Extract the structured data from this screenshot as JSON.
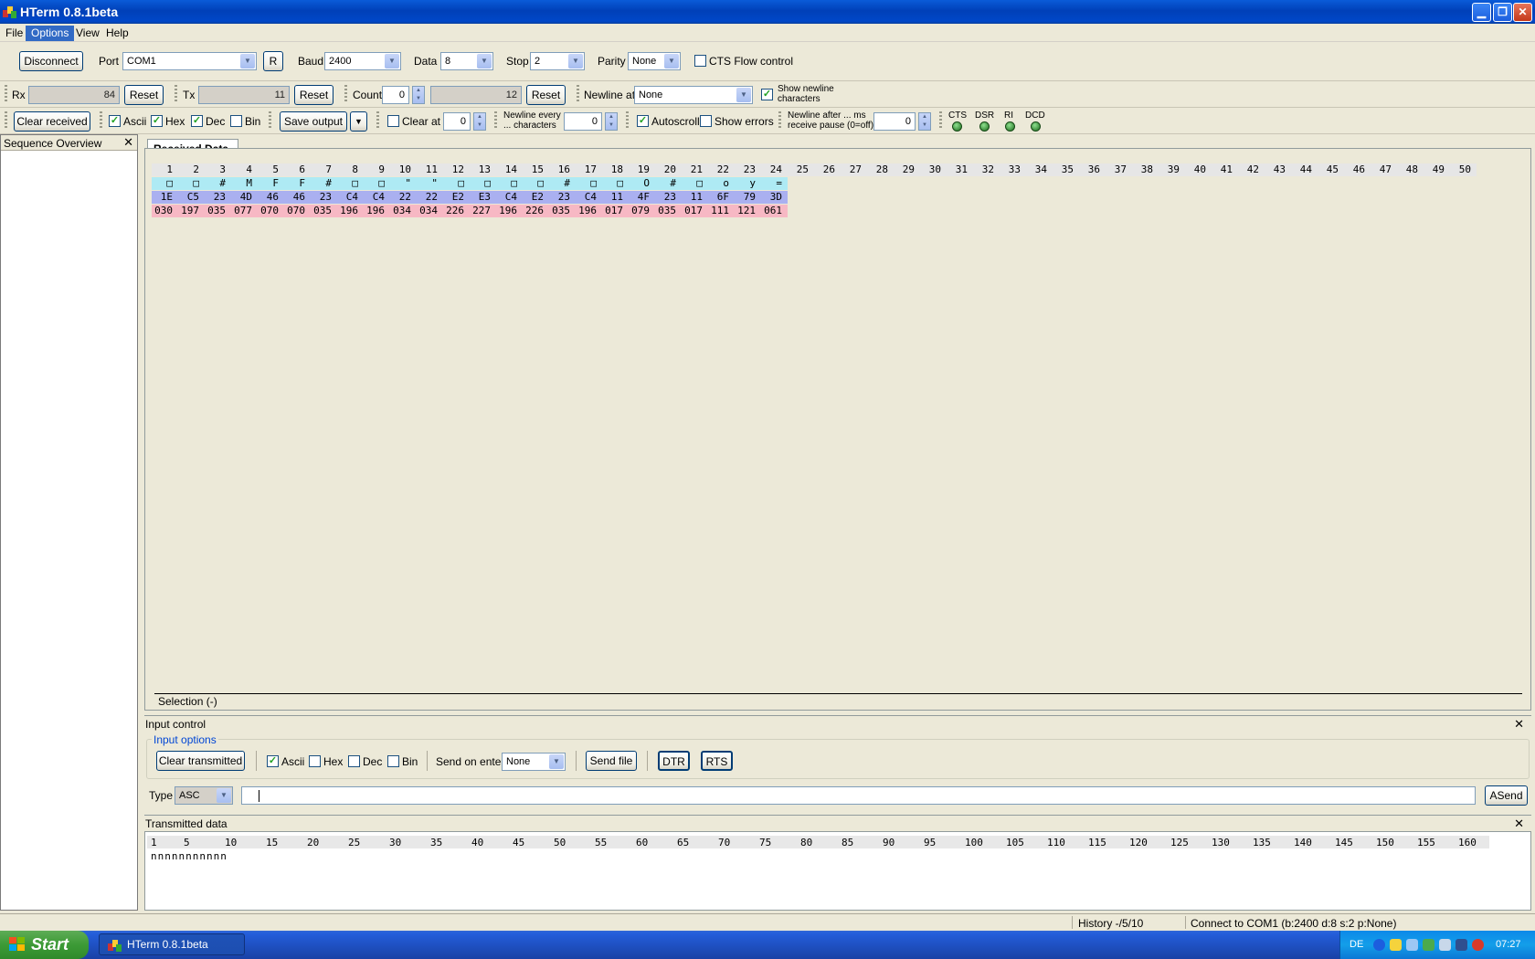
{
  "window": {
    "title": "HTerm 0.8.1beta"
  },
  "menu": [
    "File",
    "Options",
    "View",
    "Help"
  ],
  "connection": {
    "disconnect": "Disconnect",
    "port_label": "Port",
    "port_value": "COM1",
    "r_button": "R",
    "baud_label": "Baud",
    "baud_value": "2400",
    "data_label": "Data",
    "data_value": "8",
    "stop_label": "Stop",
    "stop_value": "2",
    "parity_label": "Parity",
    "parity_value": "None",
    "cts_label": "CTS Flow control"
  },
  "counters": {
    "rx_label": "Rx",
    "rx_value": "84",
    "rx_reset": "Reset",
    "tx_label": "Tx",
    "tx_value": "11",
    "tx_reset": "Reset",
    "count_label": "Count",
    "count_value": "0",
    "count_display": "12",
    "count_reset": "Reset",
    "newline_label": "Newline at",
    "newline_value": "None",
    "show_newline": "Show newline characters"
  },
  "receive_options": {
    "clear_received": "Clear received",
    "ascii": "Ascii",
    "hex": "Hex",
    "dec": "Dec",
    "bin": "Bin",
    "save_output": "Save output",
    "clear_at": "Clear at",
    "clear_at_value": "0",
    "newline_every_1": "Newline every",
    "newline_every_2": "... characters",
    "newline_every_value": "0",
    "autoscroll": "Autoscroll",
    "show_errors": "Show errors",
    "newline_after_1": "Newline after ... ms",
    "newline_after_2": "receive pause (0=off)",
    "newline_after_value": "0",
    "signals": [
      "CTS",
      "DSR",
      "RI",
      "DCD"
    ]
  },
  "sidebar": {
    "title": "Sequence Overview"
  },
  "received": {
    "tab": "Received Data",
    "columns": [
      "1",
      "2",
      "3",
      "4",
      "5",
      "6",
      "7",
      "8",
      "9",
      "10",
      "11",
      "12",
      "13",
      "14",
      "15",
      "16",
      "17",
      "18",
      "19",
      "20",
      "21",
      "22",
      "23",
      "24",
      "25",
      "26",
      "27",
      "28",
      "29",
      "30",
      "31",
      "32",
      "33",
      "34",
      "35",
      "36",
      "37",
      "38",
      "39",
      "40",
      "41",
      "42",
      "43",
      "44",
      "45",
      "46",
      "47",
      "48",
      "49",
      "50"
    ],
    "ascii": [
      "□",
      "□",
      "#",
      "M",
      "F",
      "F",
      "#",
      "□",
      "□",
      "\"",
      "\"",
      "□",
      "□",
      "□",
      "□",
      "#",
      "□",
      "□",
      "O",
      "#",
      "□",
      "o",
      "y",
      "="
    ],
    "hex": [
      "1E",
      "C5",
      "23",
      "4D",
      "46",
      "46",
      "23",
      "C4",
      "C4",
      "22",
      "22",
      "E2",
      "E3",
      "C4",
      "E2",
      "23",
      "C4",
      "11",
      "4F",
      "23",
      "11",
      "6F",
      "79",
      "3D"
    ],
    "dec": [
      "030",
      "197",
      "035",
      "077",
      "070",
      "070",
      "035",
      "196",
      "196",
      "034",
      "034",
      "226",
      "227",
      "196",
      "226",
      "035",
      "196",
      "017",
      "079",
      "035",
      "017",
      "111",
      "121",
      "061"
    ],
    "selection": "Selection (-)"
  },
  "input_control": {
    "title": "Input control",
    "options_title": "Input options",
    "clear_transmitted": "Clear transmitted",
    "ascii": "Ascii",
    "hex": "Hex",
    "dec": "Dec",
    "bin": "Bin",
    "send_on_enter_label": "Send on enter",
    "send_on_enter_value": "None",
    "send_file": "Send file",
    "dtr": "DTR",
    "rts": "RTS",
    "type_label": "Type",
    "type_value": "ASC",
    "input_value": "",
    "asend": "ASend"
  },
  "transmitted": {
    "title": "Transmitted data",
    "ruler": [
      "1",
      "5",
      "10",
      "15",
      "20",
      "25",
      "30",
      "35",
      "40",
      "45",
      "50",
      "55",
      "60",
      "65",
      "70",
      "75",
      "80",
      "85",
      "90",
      "95",
      "100",
      "105",
      "110",
      "115",
      "120",
      "125",
      "130",
      "135",
      "140",
      "145",
      "150",
      "155",
      "160"
    ],
    "content": "nnnnnnnnnnn"
  },
  "status": {
    "history": "History -/5/10",
    "connection": "Connect to COM1 (b:2400 d:8 s:2 p:None)"
  },
  "taskbar": {
    "start": "Start",
    "task": "HTerm 0.8.1beta",
    "lang": "DE",
    "clock": "07:27"
  }
}
